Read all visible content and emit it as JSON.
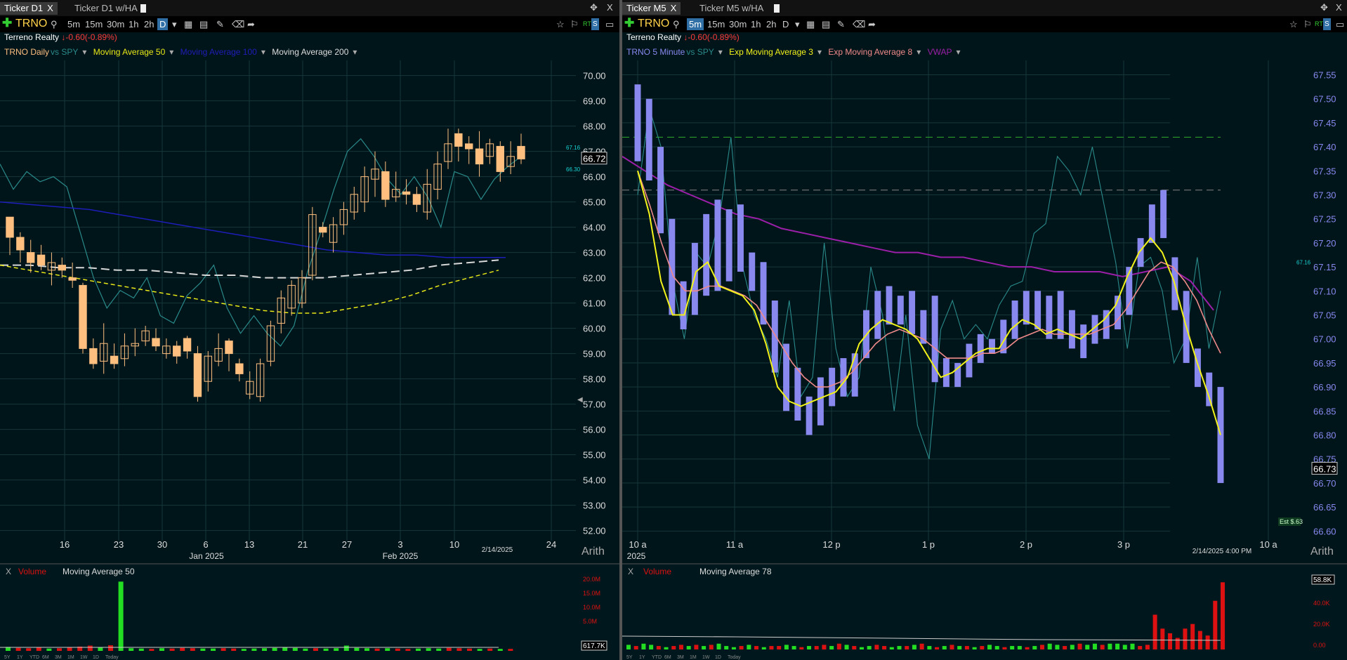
{
  "colors": {
    "bull_candle": "#ffbf7f",
    "ha_bar": "#8888ee",
    "ma50": "#e8e817",
    "ma100": "#1d1db8",
    "ma200": "#d8d8d8",
    "spy": "#2a8a8a",
    "ema3": "#f2f21a",
    "ema8": "#f08a8a",
    "vwap": "#9b1fa8",
    "vol_up": "#22dd22",
    "vol_down": "#dd1111",
    "neg": "#ff3b3b",
    "grid": "#16373a"
  },
  "left": {
    "tabs": [
      {
        "label": "Ticker D1",
        "active": true
      },
      {
        "label": "Ticker D1 w/HA",
        "active": false
      }
    ],
    "close_label": "X",
    "symbol": "TRNO",
    "intervals": [
      "5m",
      "15m",
      "30m",
      "1h",
      "2h",
      "D"
    ],
    "selected_interval": "D",
    "company": "Terreno Realty",
    "change": "-0.60",
    "change_pct": "(-0.89%)",
    "legend": {
      "main": "TRNO Daily",
      "vs": "vs SPY",
      "ma50": "Moving Average 50",
      "ma100": "Moving Average 100",
      "ma200": "Moving Average 200"
    },
    "scale_mode": "Arith",
    "date_marker": "2/14/2025",
    "volume_legend": {
      "close": "X",
      "volume": "Volume",
      "ma": "Moving Average 50"
    },
    "volume_last": "617.7K",
    "range_buttons": [
      "5Y",
      "1Y",
      "YTD",
      "6M",
      "3M",
      "1M",
      "1W",
      "1D",
      "Today"
    ]
  },
  "right": {
    "tabs": [
      {
        "label": "Ticker M5",
        "active": true
      },
      {
        "label": "Ticker M5 w/HA",
        "active": false
      }
    ],
    "close_label": "X",
    "symbol": "TRNO",
    "intervals": [
      "5m",
      "15m",
      "30m",
      "1h",
      "2h",
      "D"
    ],
    "selected_interval": "5m",
    "company": "Terreno Realty",
    "change": "-0.60",
    "change_pct": "(-0.89%)",
    "legend": {
      "main": "TRNO 5 Minute",
      "vs": "vs SPY",
      "ema3": "Exp Moving Average 3",
      "ema8": "Exp Moving Average 8",
      "vwap": "VWAP"
    },
    "scale_mode": "Arith",
    "date_marker": "2/14/2025 4:00 PM",
    "est_label": "Est $.63",
    "volume_legend": {
      "close": "X",
      "volume": "Volume",
      "ma": "Moving Average 78"
    },
    "volume_last": "58.8K",
    "range_buttons": [
      "5Y",
      "1Y",
      "YTD",
      "6M",
      "3M",
      "1M",
      "1W",
      "1D",
      "Today"
    ]
  },
  "chart_data": [
    {
      "type": "candlestick",
      "title": "TRNO Daily",
      "y_ticks": [
        70,
        69,
        68,
        67,
        66,
        65,
        64,
        63,
        62,
        61,
        60,
        59,
        58,
        57,
        56,
        55,
        54,
        53,
        52
      ],
      "ylim": [
        51.6,
        70.6
      ],
      "x_ticks": [
        "16",
        "23",
        "30",
        "6",
        "13",
        "21",
        "27",
        "3",
        "10",
        "24"
      ],
      "x_ticks_sub": [
        "Jan 2025",
        "Feb 2025"
      ],
      "last_price": "66.72",
      "markers": [
        "67.16",
        "66.30"
      ],
      "candles": [
        [
          64.4,
          63.6,
          64.3,
          62.9
        ],
        [
          63.6,
          63.1,
          63.8,
          62.6
        ],
        [
          63.0,
          62.6,
          63.5,
          62.2
        ],
        [
          62.9,
          62.5,
          63.3,
          62.3
        ],
        [
          62.3,
          62.6,
          63.0,
          61.7
        ],
        [
          62.5,
          62.3,
          62.8,
          62.0
        ],
        [
          62.0,
          61.9,
          62.6,
          61.6
        ],
        [
          61.7,
          59.2,
          61.8,
          59.0
        ],
        [
          59.2,
          58.6,
          59.6,
          58.4
        ],
        [
          58.7,
          59.4,
          60.2,
          58.2
        ],
        [
          58.9,
          58.6,
          59.4,
          58.4
        ],
        [
          58.8,
          59.3,
          59.8,
          58.5
        ],
        [
          59.3,
          59.4,
          60.0,
          58.9
        ],
        [
          59.5,
          59.9,
          60.1,
          59.3
        ],
        [
          59.6,
          59.3,
          60.0,
          59.1
        ],
        [
          59.0,
          59.3,
          59.6,
          58.8
        ],
        [
          59.3,
          58.9,
          59.5,
          58.6
        ],
        [
          59.6,
          59.1,
          59.7,
          58.8
        ],
        [
          59.0,
          57.3,
          59.3,
          57.1
        ],
        [
          57.9,
          58.9,
          59.1,
          57.5
        ],
        [
          58.7,
          59.2,
          59.8,
          58.5
        ],
        [
          59.5,
          59.0,
          59.6,
          58.3
        ],
        [
          58.6,
          58.2,
          58.8,
          57.9
        ],
        [
          57.4,
          57.9,
          58.3,
          57.2
        ],
        [
          57.3,
          58.6,
          58.8,
          57.1
        ],
        [
          58.7,
          60.1,
          60.3,
          58.5
        ],
        [
          60.2,
          61.2,
          61.5,
          59.8
        ],
        [
          60.8,
          61.7,
          61.9,
          60.5
        ],
        [
          61.0,
          62.0,
          62.3,
          60.8
        ],
        [
          62.1,
          64.5,
          64.8,
          61.9
        ],
        [
          64.0,
          63.8,
          64.2,
          63.6
        ],
        [
          63.4,
          64.1,
          64.4,
          63.0
        ],
        [
          64.1,
          64.7,
          65.0,
          63.7
        ],
        [
          64.6,
          65.3,
          65.6,
          64.3
        ],
        [
          65.0,
          66.0,
          66.4,
          64.6
        ],
        [
          65.9,
          66.3,
          67.0,
          65.2
        ],
        [
          66.2,
          65.1,
          66.6,
          64.8
        ],
        [
          65.2,
          65.5,
          66.2,
          65.0
        ],
        [
          65.4,
          65.3,
          65.9,
          64.9
        ],
        [
          65.3,
          64.9,
          65.6,
          64.6
        ],
        [
          64.6,
          65.7,
          66.3,
          64.3
        ],
        [
          65.5,
          66.5,
          67.0,
          65.1
        ],
        [
          66.6,
          67.3,
          67.9,
          66.3
        ],
        [
          67.7,
          67.2,
          67.9,
          66.6
        ],
        [
          67.3,
          67.1,
          67.6,
          66.5
        ],
        [
          67.1,
          66.5,
          67.8,
          66.0
        ],
        [
          66.8,
          67.3,
          67.5,
          66.5
        ],
        [
          67.2,
          66.2,
          67.4,
          65.8
        ],
        [
          66.4,
          66.8,
          67.4,
          66.1
        ],
        [
          67.2,
          66.7,
          67.7,
          66.5
        ]
      ],
      "ma50": [
        62.5,
        62.3,
        62.1,
        61.9,
        61.7,
        61.5,
        61.3,
        61.1,
        60.9,
        60.7,
        60.6,
        60.6,
        60.8,
        61.0,
        61.3,
        61.7,
        62.0,
        62.3
      ],
      "ma100": [
        65.0,
        64.9,
        64.8,
        64.7,
        64.5,
        64.3,
        64.1,
        63.9,
        63.7,
        63.5,
        63.3,
        63.1,
        63.0,
        62.9,
        62.9,
        62.8,
        62.8,
        62.8
      ],
      "ma200": [
        62.5,
        62.5,
        62.4,
        62.4,
        62.3,
        62.3,
        62.2,
        62.1,
        62.1,
        62.0,
        62.0,
        62.0,
        62.1,
        62.2,
        62.3,
        62.5,
        62.6,
        62.7
      ],
      "spy": [
        66.5,
        65.5,
        66.2,
        65.8,
        66.0,
        65.6,
        63.8,
        62.0,
        60.8,
        61.5,
        61.2,
        62.0,
        60.5,
        60.2,
        61.3,
        61.8,
        62.5,
        60.8,
        59.8,
        60.5,
        59.8,
        59.3,
        60.1,
        62.2,
        63.8,
        65.5,
        67.0,
        67.5,
        66.8,
        65.9,
        65.3,
        66.0,
        65.2,
        64.0,
        66.2,
        66.0,
        65.1,
        65.9,
        66.4,
        66.8
      ],
      "volume": [
        1.2,
        0.9,
        0.8,
        1.0,
        0.7,
        0.8,
        1.1,
        1.3,
        1.6,
        1.0,
        1.7,
        21.0,
        0.8,
        0.7,
        0.6,
        0.8,
        0.7,
        0.9,
        0.8,
        0.7,
        0.7,
        0.8,
        0.7,
        0.6,
        0.7,
        0.8,
        0.9,
        1.0,
        0.9,
        0.7,
        0.8,
        0.7,
        0.8,
        1.6,
        0.9,
        0.8,
        0.7,
        0.8,
        0.7,
        0.6,
        0.7,
        0.8,
        0.7,
        0.9,
        0.8,
        0.7,
        0.6,
        0.7,
        0.6,
        0.6
      ],
      "volume_up": [
        1,
        0,
        0,
        0,
        1,
        0,
        0,
        0,
        0,
        1,
        0,
        1,
        1,
        1,
        0,
        1,
        0,
        0,
        0,
        1,
        1,
        0,
        0,
        1,
        1,
        1,
        1,
        1,
        1,
        1,
        0,
        1,
        1,
        1,
        1,
        1,
        0,
        1,
        0,
        0,
        1,
        1,
        1,
        0,
        0,
        0,
        1,
        0,
        1,
        0
      ],
      "volume_ticks": [
        "20.0M",
        "15.0M",
        "10.0M",
        "5.0M"
      ]
    },
    {
      "type": "bar",
      "title": "TRNO 5 Minute",
      "y_ticks": [
        67.55,
        67.5,
        67.45,
        67.4,
        67.35,
        67.3,
        67.25,
        67.2,
        67.15,
        67.1,
        67.05,
        67.0,
        66.95,
        66.9,
        66.85,
        66.8,
        66.75,
        66.7,
        66.65,
        66.6
      ],
      "ylim": [
        66.58,
        67.58
      ],
      "x_ticks": [
        "10 a",
        "11 a",
        "12 p",
        "1 p",
        "2 p",
        "3 p",
        "10 a"
      ],
      "x_sub": "2025",
      "last_price": "66.73",
      "marker": "67.16",
      "levels": [
        67.42,
        67.31
      ],
      "bars": [
        [
          67.53,
          67.37,
          67.17
        ],
        [
          67.5,
          67.33,
          67.22
        ],
        [
          67.4,
          67.22,
          67.05
        ],
        [
          67.25,
          67.05,
          66.98
        ],
        [
          67.12,
          67.02,
          66.93
        ],
        [
          67.2,
          67.05,
          67.05
        ],
        [
          67.26,
          67.09,
          66.96
        ],
        [
          67.29,
          67.1,
          67.01
        ],
        [
          67.27,
          67.12,
          67.14
        ],
        [
          67.28,
          67.14,
          67.02
        ],
        [
          67.18,
          67.1,
          67.0
        ],
        [
          67.16,
          67.03,
          66.98
        ],
        [
          67.08,
          66.93,
          66.96
        ],
        [
          66.99,
          66.85,
          66.9
        ],
        [
          66.94,
          66.83,
          66.88
        ],
        [
          66.88,
          66.8,
          66.83
        ],
        [
          66.92,
          66.82,
          66.85
        ],
        [
          66.94,
          66.86,
          66.88
        ],
        [
          66.96,
          66.88,
          66.88
        ],
        [
          66.97,
          66.88,
          66.91
        ],
        [
          67.06,
          66.96,
          66.91
        ],
        [
          67.1,
          67.0,
          67.02
        ],
        [
          67.11,
          67.03,
          67.02
        ],
        [
          67.09,
          67.03,
          67.02
        ],
        [
          67.1,
          67.01,
          67.04
        ],
        [
          67.06,
          66.99,
          67.02
        ],
        [
          67.09,
          66.91,
          66.92
        ],
        [
          66.96,
          66.9,
          66.9
        ],
        [
          66.95,
          66.9,
          66.92
        ],
        [
          66.99,
          66.92,
          66.95
        ],
        [
          67.01,
          66.95,
          66.97
        ],
        [
          67.0,
          66.97,
          66.99
        ],
        [
          67.04,
          66.97,
          66.99
        ],
        [
          67.08,
          67.0,
          67.06
        ],
        [
          67.1,
          67.03,
          67.03
        ],
        [
          67.1,
          67.02,
          67.01
        ],
        [
          67.09,
          67.0,
          67.0
        ],
        [
          67.1,
          67.0,
          67.03
        ],
        [
          67.06,
          66.98,
          66.99
        ],
        [
          67.03,
          66.96,
          66.98
        ],
        [
          67.05,
          66.99,
          67.03
        ],
        [
          67.06,
          67.0,
          67.03
        ],
        [
          67.09,
          67.02,
          67.06
        ],
        [
          67.15,
          67.05,
          67.13
        ],
        [
          67.21,
          67.15,
          67.17
        ],
        [
          67.28,
          67.2,
          67.24
        ],
        [
          67.31,
          67.21,
          67.12
        ],
        [
          67.17,
          67.06,
          67.1
        ],
        [
          67.1,
          66.95,
          66.98
        ],
        [
          66.98,
          66.9,
          66.92
        ],
        [
          66.93,
          66.86,
          66.88
        ],
        [
          66.9,
          66.7,
          66.73
        ]
      ],
      "ema3": [
        67.35,
        67.26,
        67.12,
        67.05,
        67.05,
        67.14,
        67.16,
        67.11,
        67.1,
        67.09,
        67.06,
        66.99,
        66.9,
        66.87,
        66.86,
        66.87,
        66.88,
        66.89,
        66.92,
        66.99,
        67.02,
        67.04,
        67.03,
        67.02,
        67.0,
        66.96,
        66.92,
        66.93,
        66.95,
        66.97,
        66.98,
        66.98,
        67.02,
        67.04,
        67.03,
        67.01,
        67.02,
        67.01,
        67.0,
        67.02,
        67.04,
        67.07,
        67.13,
        67.18,
        67.21,
        67.18,
        67.12,
        67.03,
        66.95,
        66.88,
        66.8
      ],
      "ema8": [
        67.35,
        67.28,
        67.2,
        67.13,
        67.1,
        67.1,
        67.11,
        67.11,
        67.1,
        67.09,
        67.07,
        67.03,
        66.99,
        66.95,
        66.92,
        66.9,
        66.9,
        66.91,
        66.93,
        66.96,
        66.99,
        67.01,
        67.02,
        67.01,
        67.0,
        66.98,
        66.96,
        66.96,
        66.96,
        66.97,
        66.97,
        66.98,
        67.0,
        67.01,
        67.02,
        67.01,
        67.01,
        67.01,
        67.01,
        67.02,
        67.03,
        67.06,
        67.1,
        67.14,
        67.16,
        67.15,
        67.12,
        67.08,
        67.02,
        66.97
      ],
      "vwap": [
        67.38,
        67.35,
        67.32,
        67.3,
        67.28,
        67.26,
        67.25,
        67.23,
        67.22,
        67.21,
        67.2,
        67.19,
        67.18,
        67.18,
        67.17,
        67.17,
        67.16,
        67.15,
        67.15,
        67.14,
        67.14,
        67.14,
        67.13,
        67.14,
        67.15,
        67.12,
        67.06
      ],
      "spy": [
        67.3,
        67.48,
        67.4,
        67.12,
        67.0,
        67.18,
        67.15,
        67.25,
        67.42,
        67.15,
        67.05,
        67.0,
        66.92,
        67.08,
        66.88,
        66.92,
        67.2,
        66.98,
        66.88,
        66.92,
        67.15,
        67.05,
        66.85,
        67.05,
        66.82,
        66.75,
        67.02,
        67.08,
        67.0,
        67.03,
        67.0,
        67.07,
        67.11,
        67.12,
        67.22,
        67.24,
        67.38,
        67.35,
        67.3,
        67.4,
        67.28,
        67.16,
        66.98,
        67.15,
        67.17,
        67.1,
        66.95,
        67.0,
        67.17,
        66.98,
        67.1
      ],
      "volume_up": [
        1,
        0,
        1,
        1,
        0,
        1,
        0,
        0,
        1,
        0,
        1,
        0,
        1,
        1,
        1,
        0,
        1,
        0,
        1,
        0,
        0,
        1,
        1,
        0,
        1,
        0,
        0,
        1,
        0,
        1,
        0,
        1,
        1,
        0,
        0,
        1,
        1,
        0,
        1,
        0,
        1,
        0,
        1,
        0,
        1,
        0,
        1,
        0,
        1,
        1,
        0,
        1,
        1,
        0,
        1,
        0,
        1,
        1,
        0,
        1,
        0,
        1,
        1,
        0,
        1,
        1,
        1,
        1,
        0,
        0,
        0,
        0,
        0,
        0,
        0,
        0,
        0,
        0,
        0,
        0
      ],
      "volume": [
        4,
        3,
        5,
        4,
        3,
        2,
        3,
        4,
        3,
        4,
        3,
        4,
        5,
        3,
        2,
        3,
        4,
        3,
        2,
        3,
        3,
        4,
        3,
        2,
        3,
        3,
        4,
        3,
        5,
        4,
        3,
        2,
        3,
        4,
        3,
        2,
        3,
        3,
        4,
        5,
        3,
        2,
        3,
        4,
        3,
        3,
        2,
        3,
        4,
        3,
        2,
        3,
        3,
        2,
        3,
        4,
        5,
        4,
        3,
        4,
        5,
        4,
        5,
        4,
        5,
        5,
        4,
        5,
        3,
        4,
        30,
        18,
        14,
        10,
        18,
        22,
        16,
        12,
        42,
        58
      ],
      "volume_ticks": [
        "40.0K",
        "20.0K",
        "0.00"
      ]
    }
  ]
}
